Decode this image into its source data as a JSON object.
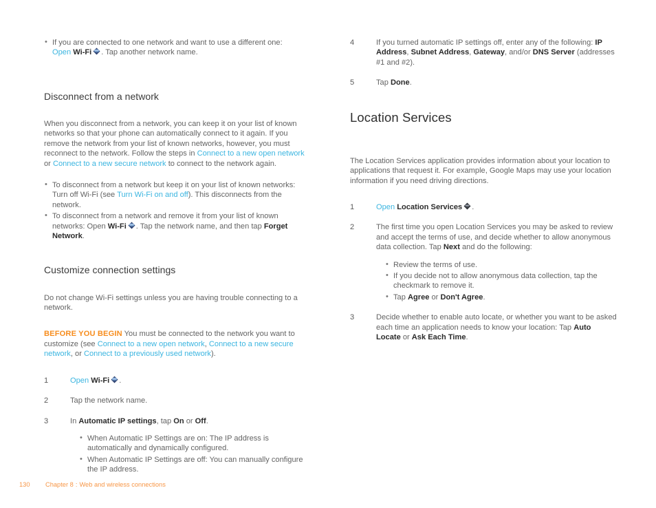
{
  "colors": {
    "link": "#3bb5e0",
    "warning": "#f78d1e",
    "body_text": "#636363",
    "heading": "#2f2f2f",
    "footer": "#f79646",
    "background": "#ffffff"
  },
  "icons": {
    "wifi": "wifi-globe-icon",
    "location": "location-services-globe-icon"
  },
  "left_column": {
    "top_bullet": {
      "line1": "If you are connected to one network and want to use a different one:",
      "link_open": "Open",
      "bold_wifi": "Wi-Fi",
      "tail": ". Tap another network name."
    },
    "heading_disconnect": "Disconnect from a network",
    "disconnect_paragraph": {
      "part1": "When you disconnect from a network, you can keep it on your list of known networks so that your phone can automatically connect to it again. If you remove the network from your list of known networks, however, you must reconnect to the network. Follow the steps in ",
      "link1": "Connect to a new open network",
      "mid": " or ",
      "link2": "Connect to a new secure network",
      "part2": " to connect to the network again."
    },
    "disconnect_bullets": {
      "b1_pre": "To disconnect from a network but keep it on your list of known networks: Turn off Wi-Fi (see ",
      "b1_link": "Turn Wi-Fi on and off",
      "b1_post": "). This disconnects from the network.",
      "b2_pre": "To disconnect from a network and remove it from your list of known networks: Open ",
      "b2_bold_wifi": "Wi-Fi",
      "b2_mid": ". Tap the network name, and then tap ",
      "b2_bold_forget": "Forget Network",
      "b2_post": "."
    },
    "heading_customize": "Customize connection settings",
    "customize_paragraph": "Do not change Wi-Fi settings unless you are having trouble connecting to a network.",
    "before_you_begin": {
      "label": "BEFORE YOU BEGIN",
      "pre": "  You must be connected to the network you want to customize (see ",
      "link1": "Connect to a new open network",
      "sep1": ", ",
      "link2": "Connect to a new secure network",
      "sep2": ", or ",
      "link3": "Connect to a previously used network",
      "post": ")."
    },
    "steps": [
      {
        "num": "1",
        "link_open": "Open",
        "bold": "Wi-Fi",
        "tail": "."
      },
      {
        "num": "2",
        "text": "Tap the network name."
      },
      {
        "num": "3",
        "pre": "In ",
        "bold1": "Automatic IP settings",
        "mid": ", tap ",
        "bold2": "On",
        "mid2": " or ",
        "bold3": "Off",
        "post": ".",
        "sub_bullets": [
          "When Automatic IP Settings are on: The IP address is automatically and dynamically configured.",
          "When Automatic IP Settings are off: You can manually configure the IP address."
        ]
      }
    ]
  },
  "right_column": {
    "steps_continued": [
      {
        "num": "4",
        "pre": "If you turned automatic IP settings off, enter any of the following: ",
        "bold1": "IP Address",
        "sep1": ", ",
        "bold2": "Subnet Address",
        "sep2": ", ",
        "bold3": "Gateway",
        "sep3": ", and/or ",
        "bold4": "DNS Server",
        "post": " (addresses #1 and #2)."
      },
      {
        "num": "5",
        "pre": "Tap ",
        "bold1": "Done",
        "post": "."
      }
    ],
    "heading_location_services": "Location Services",
    "location_paragraph": "The Location Services application provides information about your location to applications that request it. For example, Google Maps may use your location information if you need driving directions.",
    "steps": [
      {
        "num": "1",
        "link_open": "Open",
        "bold": "Location Services",
        "tail": "."
      },
      {
        "num": "2",
        "pre": "The first time you open Location Services you may be asked to review and accept the terms of use, and decide whether to allow anonymous data collection. Tap ",
        "bold1": "Next",
        "post": " and do the following:",
        "sub_bullets": [
          {
            "text": "Review the terms of use."
          },
          {
            "text": "If you decide not to allow anonymous data collection, tap the checkmark to remove it."
          },
          {
            "pre": "Tap ",
            "bold1": "Agree",
            "mid": " or ",
            "bold2": "Don't Agree",
            "post": "."
          }
        ]
      },
      {
        "num": "3",
        "pre": "Decide whether to enable auto locate, or whether you want to be asked each time an application needs to know your location: Tap ",
        "bold1": "Auto Locate",
        "mid": " or ",
        "bold2": "Ask Each Time",
        "post": "."
      }
    ]
  },
  "footer": {
    "page_number": "130",
    "chapter": "Chapter 8",
    "separator": ":",
    "chapter_title": "Web and wireless connections"
  }
}
